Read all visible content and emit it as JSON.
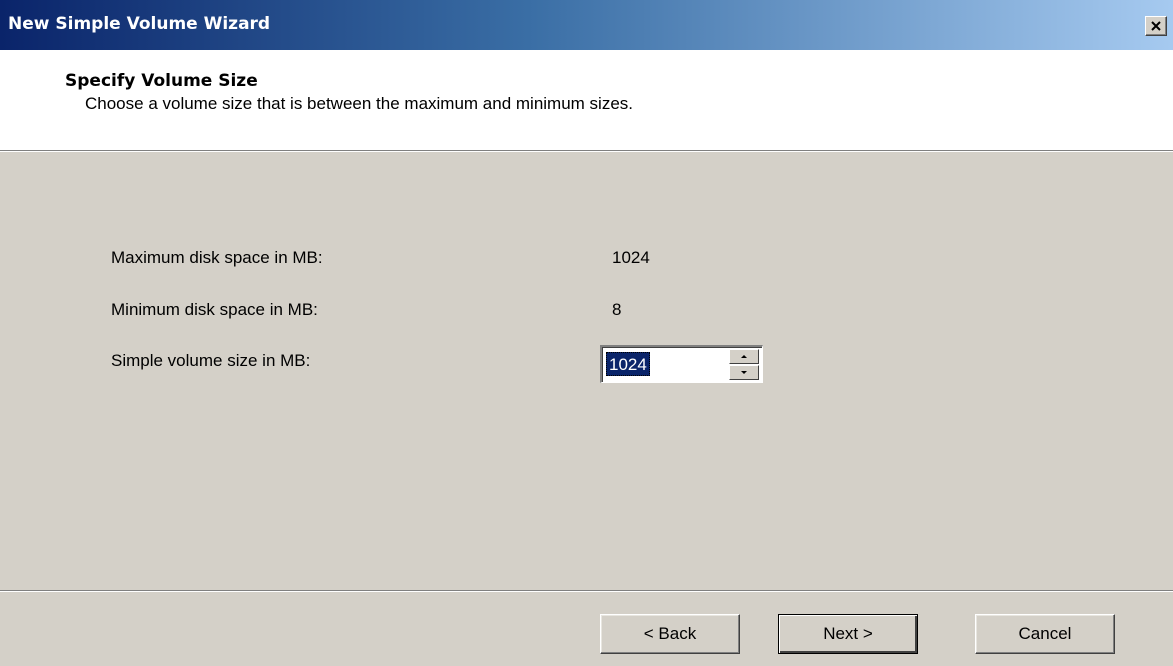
{
  "window": {
    "title": "New Simple Volume Wizard",
    "close_icon": "close-icon"
  },
  "header": {
    "title": "Specify Volume Size",
    "subtitle": "Choose a volume size that is between the maximum and minimum sizes."
  },
  "fields": {
    "max_label": "Maximum disk space in MB:",
    "max_value": "1024",
    "min_label": "Minimum disk space in MB:",
    "min_value": "8",
    "size_label": "Simple volume size in MB:",
    "size_value": "1024"
  },
  "buttons": {
    "back": "< Back",
    "next": "Next >",
    "cancel": "Cancel"
  },
  "colors": {
    "title_bar_start": "#0a246a",
    "title_bar_end": "#a6caf0",
    "dialog_face": "#d4d0c8",
    "selection": "#0a246a"
  }
}
